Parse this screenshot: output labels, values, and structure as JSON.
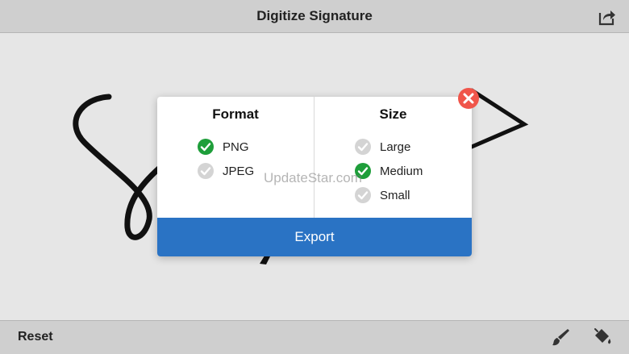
{
  "header": {
    "title": "Digitize Signature",
    "share_icon": "share-icon"
  },
  "footer": {
    "reset_label": "Reset",
    "brush_icon": "brush-icon",
    "bucket_icon": "paint-bucket-icon"
  },
  "dialog": {
    "format": {
      "title": "Format",
      "options": [
        {
          "label": "PNG",
          "selected": true
        },
        {
          "label": "JPEG",
          "selected": false
        }
      ]
    },
    "size": {
      "title": "Size",
      "options": [
        {
          "label": "Large",
          "selected": false
        },
        {
          "label": "Medium",
          "selected": true
        },
        {
          "label": "Small",
          "selected": false
        }
      ]
    },
    "export_label": "Export",
    "close_icon": "close-icon"
  },
  "watermark": "UpdateStar.com",
  "colors": {
    "accent": "#2a73c4",
    "check_selected": "#1e9e3a",
    "check_unselected": "#d4d4d4",
    "close": "#f0554a"
  }
}
